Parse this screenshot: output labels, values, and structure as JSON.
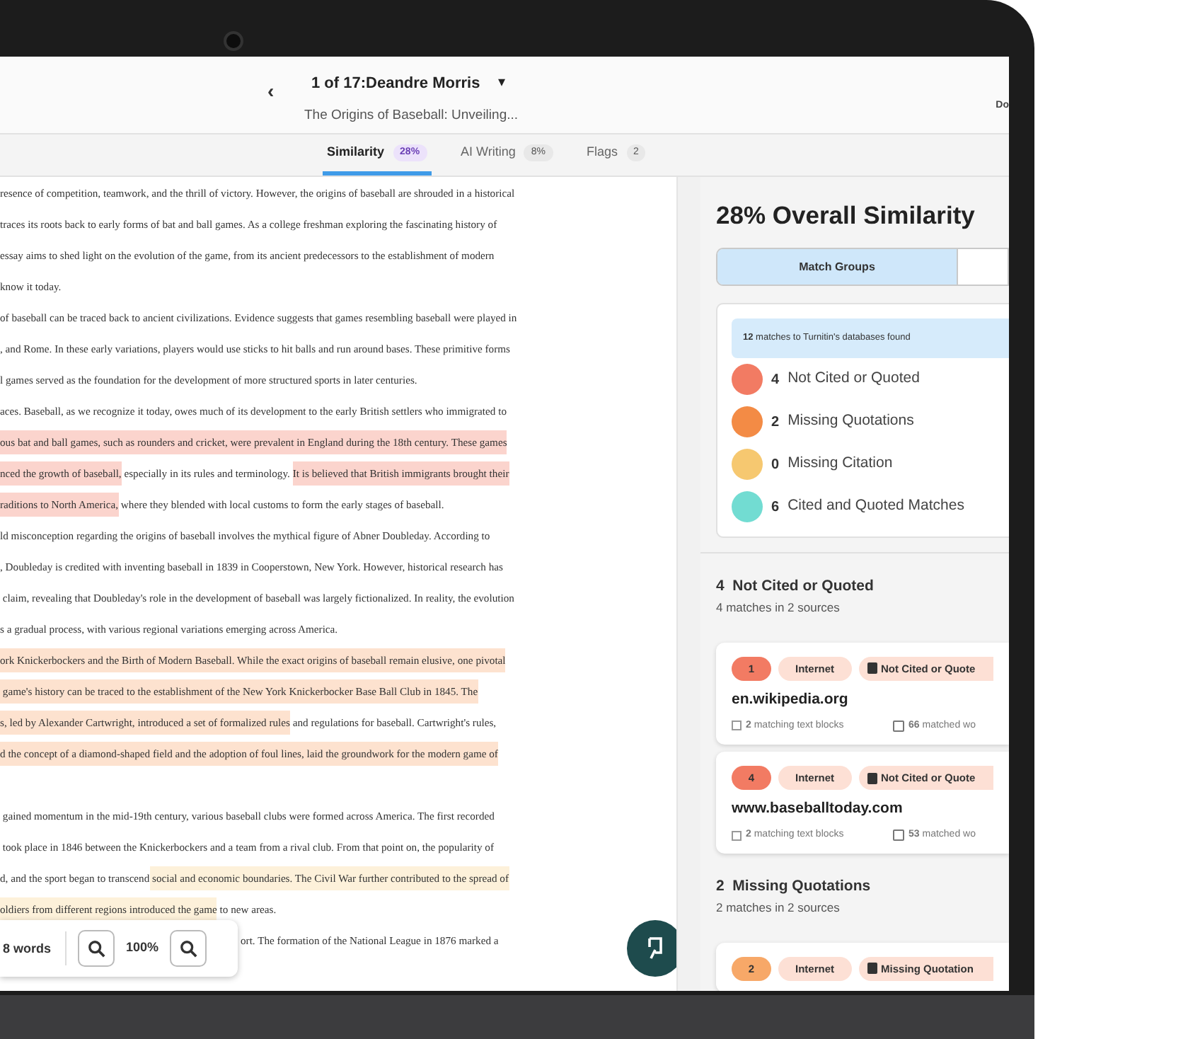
{
  "header": {
    "title": "1 of 17:Deandre Morris",
    "caret": "▾",
    "back": "‹",
    "subtitle": "The Origins of Baseball: Unveiling...",
    "right_text": "Do"
  },
  "tabs": [
    {
      "label": "Similarity",
      "badge": "28%",
      "selected": true
    },
    {
      "label": "AI Writing",
      "badge": "8%",
      "selected": false
    },
    {
      "label": "Flags",
      "badge": "2",
      "selected": false
    }
  ],
  "document": {
    "lines": [
      {
        "segments": [
          {
            "text": "resence of competition, teamwork, and the thrill of victory. However, the origins of baseball are shrouded in a historical"
          }
        ]
      },
      {
        "segments": [
          {
            "text": "traces its roots back to early forms of bat and ball games. As a college freshman exploring the fascinating history of"
          }
        ]
      },
      {
        "segments": [
          {
            "text": "essay aims to shed light on the evolution of the game, from its ancient predecessors to the establishment of modern"
          }
        ]
      },
      {
        "segments": [
          {
            "text": "know it today."
          }
        ]
      },
      {
        "segments": [
          {
            "text": "of baseball can be traced back to ancient civilizations. Evidence suggests that games resembling baseball were played in"
          }
        ]
      },
      {
        "segments": [
          {
            "text": ", and Rome. In these early variations, players would use sticks to hit balls and run around bases. These primitive forms"
          }
        ]
      },
      {
        "segments": [
          {
            "text": "l games served as the foundation for the development of more structured sports in later centuries."
          }
        ]
      },
      {
        "segments": [
          {
            "text": "aces. Baseball, as we recognize it today, owes much of its development to the early British settlers who immigrated to"
          }
        ]
      },
      {
        "segments": [
          {
            "text": "ous bat and ball games, such as rounders and cricket, were prevalent in England during the 18th century. These games",
            "color": "#fbd4cd"
          }
        ]
      },
      {
        "segments": [
          {
            "text": "nced the growth of baseball,",
            "color": "#fbd4cd"
          },
          {
            "text": " especially in its rules and terminology. "
          },
          {
            "text": "It is believed that British immigrants brought their",
            "color": "#fbd4cd"
          }
        ]
      },
      {
        "segments": [
          {
            "text": "raditions to North America,",
            "color": "#fbd4cd"
          },
          {
            "text": " where they blended with local customs to form the early stages of baseball."
          }
        ]
      },
      {
        "segments": [
          {
            "text": "ld misconception regarding the origins of baseball involves the mythical figure of Abner Doubleday. According to"
          }
        ]
      },
      {
        "segments": [
          {
            "text": ", Doubleday is credited with inventing baseball in 1839 in Cooperstown, New York. However, historical research has"
          }
        ]
      },
      {
        "segments": [
          {
            "text": " claim, revealing that Doubleday's role in the development of baseball was largely fictionalized. In reality, the evolution"
          }
        ]
      },
      {
        "segments": [
          {
            "text": "s a gradual process, with various regional variations emerging across America."
          }
        ]
      },
      {
        "segments": [
          {
            "text": "ork Knickerbockers and the Birth of Modern Baseball. While the exact origins of baseball remain elusive, one pivotal",
            "color": "#fde2cf"
          }
        ]
      },
      {
        "segments": [
          {
            "text": " game's history can be traced to the establishment of the New York Knickerbocker Base Ball Club in 1845. The",
            "color": "#fde2cf"
          }
        ]
      },
      {
        "segments": [
          {
            "text": "s, led by Alexander Cartwright, introduced a set of formalized rules",
            "color": "#fde2cf"
          },
          {
            "text": " and regulations for baseball. Cartwright's rules,"
          }
        ]
      },
      {
        "segments": [
          {
            "text": "d the concept of a diamond-shaped field and the adoption of foul lines, laid the groundwork for the modern game of",
            "color": "#fde2cf"
          }
        ]
      },
      {
        "space_before": true,
        "segments": [
          {
            "text": " gained momentum in the mid-19th century, various baseball clubs were formed across America. The first recorded"
          }
        ]
      },
      {
        "segments": [
          {
            "text": " took place in 1846 between the Knickerbockers and a team from a rival club. From that point on, the popularity of"
          }
        ]
      },
      {
        "segments": [
          {
            "text": "d, and the sport began to transcend"
          },
          {
            "text": " social and economic boundaries. The Civil War further contributed to the spread of",
            "color": "#fdf1da"
          }
        ]
      },
      {
        "segments": [
          {
            "text": "oldiers from different regions introduced the game",
            "color": "#fdf1da"
          },
          {
            "text": " to new areas."
          }
        ]
      },
      {
        "partly_covered": true,
        "segments": [
          {
            "text": "ort. The formation of the National League in 1876 marked a"
          }
        ]
      }
    ]
  },
  "zoom_bar": {
    "words": "8 words",
    "zoom": "100%"
  },
  "panel": {
    "title": "28% Overall Similarity",
    "segments": [
      {
        "label": "Match Groups",
        "selected": true
      },
      {
        "selected": false
      }
    ],
    "banner": "**12** matches to Turnitin's databases found",
    "categories": [
      {
        "count": "4",
        "label": "Not Cited or Quoted",
        "color": "#f27b63"
      },
      {
        "count": "2",
        "label": "Missing Quotations",
        "color": "#f38b45"
      },
      {
        "count": "0",
        "label": "Missing Citation",
        "color": "#f6c870"
      },
      {
        "count": "6",
        "label": "Cited and Quoted Matches",
        "color": "#72dcd2"
      }
    ],
    "groups": [
      {
        "title": "4  Not Cited or Quoted",
        "subtitle": "4 matches in 2 sources",
        "color": "#f27b63",
        "sources": [
          {
            "number": "1",
            "type": "Internet",
            "tag": "Not Cited or Quote",
            "domain": "en.wikipedia.org",
            "blocks": "**2** matching text blocks",
            "words": "**66** matched wo"
          },
          {
            "number": "4",
            "type": "Internet",
            "tag": "Not Cited or Quote",
            "domain": "www.baseballtoday.com",
            "blocks": "**2** matching text blocks",
            "words": "**53** matched wo"
          }
        ]
      },
      {
        "title": "2  Missing Quotations",
        "subtitle": "2 matches in 2 sources",
        "color": "#f7a868",
        "sources": [
          {
            "number": "2",
            "type": "Internet",
            "tag": "Missing Quotation"
          }
        ]
      }
    ]
  }
}
